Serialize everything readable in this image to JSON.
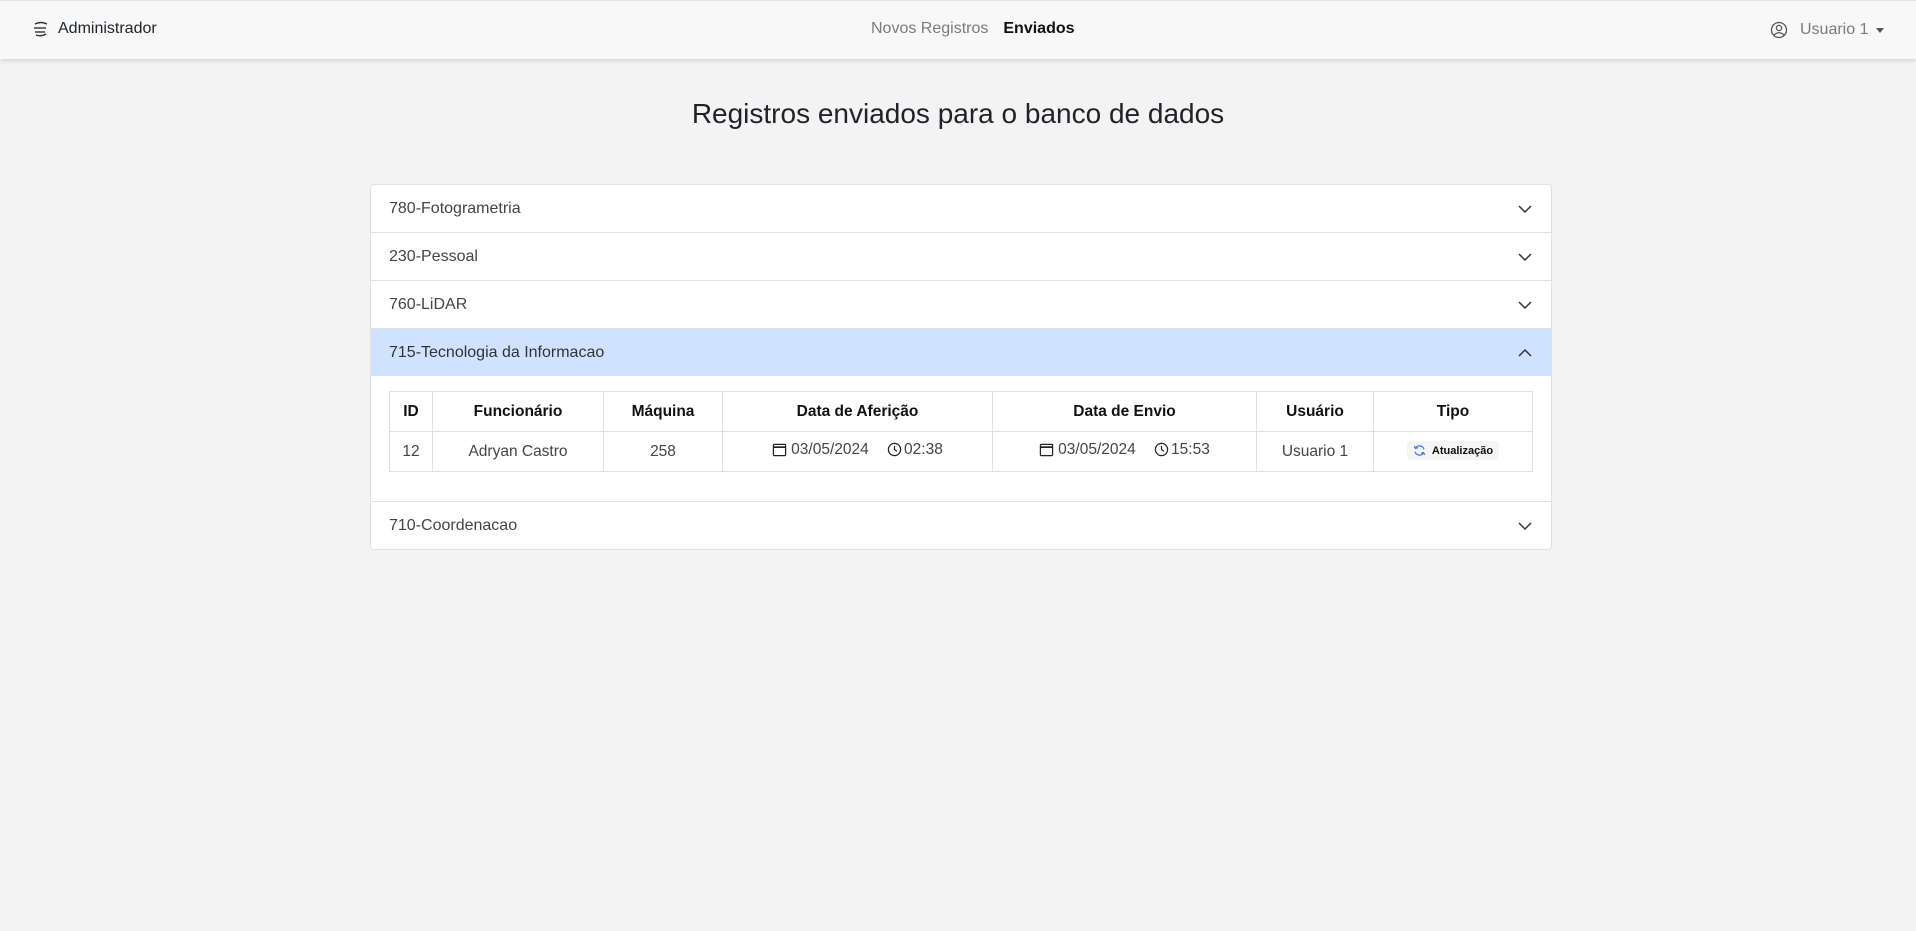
{
  "navbar": {
    "brand": "Administrador",
    "links": [
      {
        "label": "Novos Registros",
        "active": false
      },
      {
        "label": "Enviados",
        "active": true
      }
    ],
    "user": "Usuario 1"
  },
  "page": {
    "title": "Registros enviados para o banco de dados"
  },
  "accordion": {
    "items": [
      {
        "label": "780-Fotogrametria",
        "expanded": false
      },
      {
        "label": "230-Pessoal",
        "expanded": false
      },
      {
        "label": "760-LiDAR",
        "expanded": false
      },
      {
        "label": "715-Tecnologia da Informacao",
        "expanded": true
      },
      {
        "label": "710-Coordenacao",
        "expanded": false
      }
    ]
  },
  "table": {
    "headers": [
      "ID",
      "Funcionário",
      "Máquina",
      "Data de Aferição",
      "Data de Envio",
      "Usuário",
      "Tipo"
    ],
    "rows": [
      {
        "id": "12",
        "funcionario": "Adryan Castro",
        "maquina": "258",
        "afericao_data": "03/05/2024",
        "afericao_hora": "02:38",
        "envio_data": "03/05/2024",
        "envio_hora": "15:53",
        "usuario": "Usuario 1",
        "tipo": "Atualização"
      }
    ]
  },
  "colors": {
    "background": "#f3f3f3",
    "expanded_header": "#cfe2ff",
    "refresh_icon": "#3d7be0"
  },
  "icons": {
    "brand": "menu-lines-icon",
    "user": "user-circle-icon",
    "collapsed": "chevron-down-icon",
    "expanded": "chevron-up-icon",
    "date": "calendar-icon",
    "time": "clock-icon",
    "tipo": "refresh-icon"
  }
}
